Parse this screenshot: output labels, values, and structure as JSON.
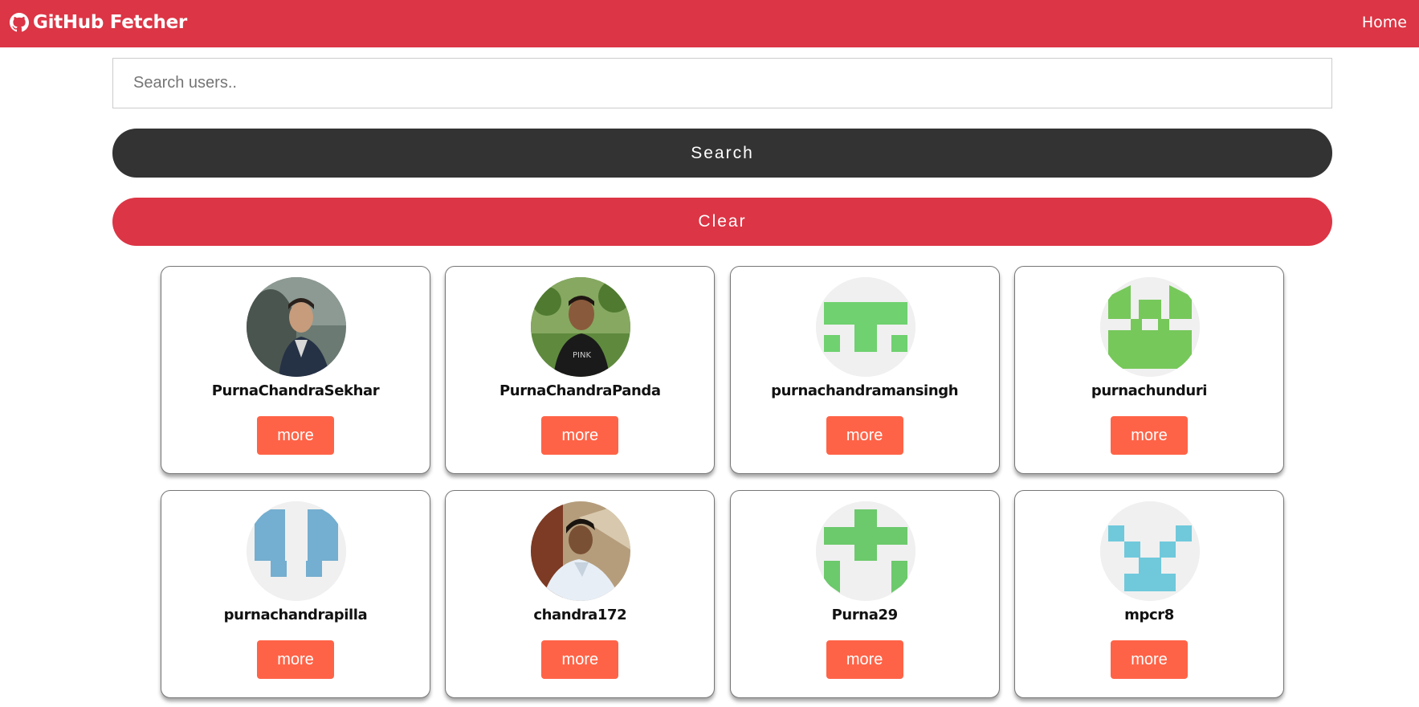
{
  "navbar": {
    "brand": "GitHub Fetcher",
    "brand_icon": "github-icon",
    "home_link": "Home",
    "bg_color": "#dc3545"
  },
  "search": {
    "placeholder": "Search users..",
    "value": "",
    "search_label": "Search",
    "clear_label": "Clear"
  },
  "colors": {
    "search_button": "#333333",
    "clear_button": "#dc3545",
    "more_button": "#ff6347"
  },
  "users": [
    {
      "login": "PurnaChandraSekhar",
      "avatar": "photo-portrait",
      "more_label": "more"
    },
    {
      "login": "PurnaChandraPanda",
      "avatar": "photo-portrait",
      "more_label": "more"
    },
    {
      "login": "purnachandramansingh",
      "avatar": "identicon-green",
      "more_label": "more"
    },
    {
      "login": "purnachunduri",
      "avatar": "identicon-green",
      "more_label": "more"
    },
    {
      "login": "purnachandrapilla",
      "avatar": "identicon-blue",
      "more_label": "more"
    },
    {
      "login": "chandra172",
      "avatar": "photo-portrait",
      "more_label": "more"
    },
    {
      "login": "Purna29",
      "avatar": "identicon-green",
      "more_label": "more"
    },
    {
      "login": "mpcr8",
      "avatar": "identicon-cyan",
      "more_label": "more"
    }
  ]
}
